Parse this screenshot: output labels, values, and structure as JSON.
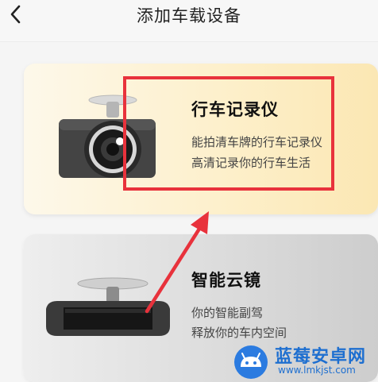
{
  "header": {
    "title": "添加车载设备",
    "back_icon": "chevron-left-icon"
  },
  "devices": [
    {
      "title": "行车记录仪",
      "description_lines": [
        "能拍清车牌的行车记录仪",
        "高清记录你的行车生活"
      ],
      "icon": "dashcam-icon"
    },
    {
      "title": "智能云镜",
      "description_lines": [
        "你的智能副驾",
        "释放你的车内空间"
      ],
      "icon": "smart-mirror-icon"
    }
  ],
  "annotation": {
    "highlight_color": "#e8323c"
  },
  "watermark": {
    "title": "蓝莓安卓网",
    "url": "www.lmkjst.com"
  },
  "colors": {
    "dashcam_card": "#fdefc9",
    "mirror_card": "#dcdcdc",
    "watermark_blue": "#1e6fd0"
  }
}
